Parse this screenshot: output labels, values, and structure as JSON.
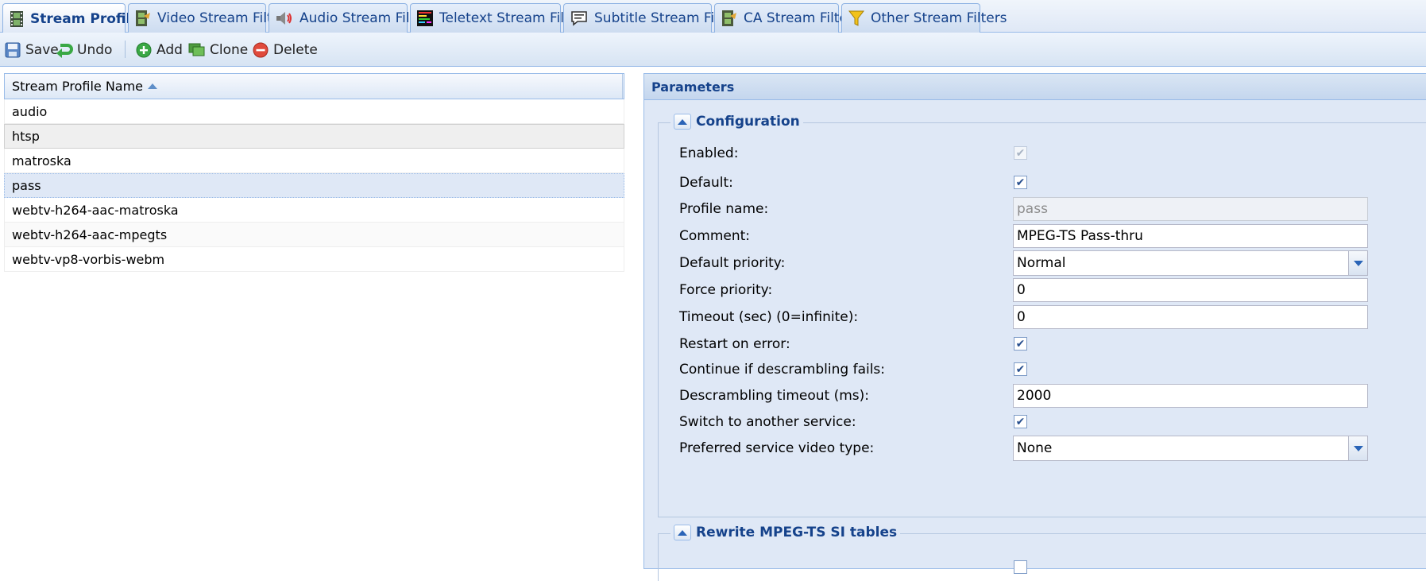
{
  "tabs": [
    {
      "label": "Stream Profiles",
      "icon": "film-strip-icon",
      "active": true
    },
    {
      "label": "Video Stream Filters",
      "icon": "video-filter-icon"
    },
    {
      "label": "Audio Stream Filters",
      "icon": "speaker-icon"
    },
    {
      "label": "Teletext Stream Filters",
      "icon": "teletext-icon"
    },
    {
      "label": "Subtitle Stream Filters",
      "icon": "speech-bubble-icon"
    },
    {
      "label": "CA Stream Filters",
      "icon": "ca-filter-icon"
    },
    {
      "label": "Other Stream Filters",
      "icon": "funnel-icon"
    }
  ],
  "toolbar": {
    "save_label": "Save",
    "undo_label": "Undo",
    "add_label": "Add",
    "clone_label": "Clone",
    "delete_label": "Delete"
  },
  "grid": {
    "column_header": "Stream Profile Name",
    "sort": "ascending",
    "rows": [
      "audio",
      "htsp",
      "matroska",
      "pass",
      "webtv-h264-aac-matroska",
      "webtv-h264-aac-mpegts",
      "webtv-vp8-vorbis-webm"
    ],
    "selected_row": "pass"
  },
  "panel": {
    "title": "Parameters",
    "configuration": {
      "legend": "Configuration",
      "enabled_label": "Enabled:",
      "enabled_checked": true,
      "default_label": "Default:",
      "default_checked": true,
      "profile_name_label": "Profile name:",
      "profile_name_value": "pass",
      "comment_label": "Comment:",
      "comment_value": "MPEG-TS Pass-thru",
      "default_priority_label": "Default priority:",
      "default_priority_value": "Normal",
      "force_priority_label": "Force priority:",
      "force_priority_value": "0",
      "timeout_label": "Timeout (sec) (0=infinite):",
      "timeout_value": "0",
      "restart_label": "Restart on error:",
      "restart_checked": true,
      "continue_label": "Continue if descrambling fails:",
      "continue_checked": true,
      "descrambling_timeout_label": "Descrambling timeout (ms):",
      "descrambling_timeout_value": "2000",
      "switch_label": "Switch to another service:",
      "switch_checked": true,
      "preferred_video_label": "Preferred service video type:",
      "preferred_video_value": "None"
    },
    "rewrite": {
      "legend": "Rewrite MPEG-TS SI tables"
    }
  },
  "colors": {
    "accent": "#15428b",
    "border": "#99bbe8",
    "panel_bg": "#dfe8f6",
    "selected_row": "#dfe8f6",
    "delete_red": "#e04a3c",
    "add_green": "#3aa845"
  }
}
